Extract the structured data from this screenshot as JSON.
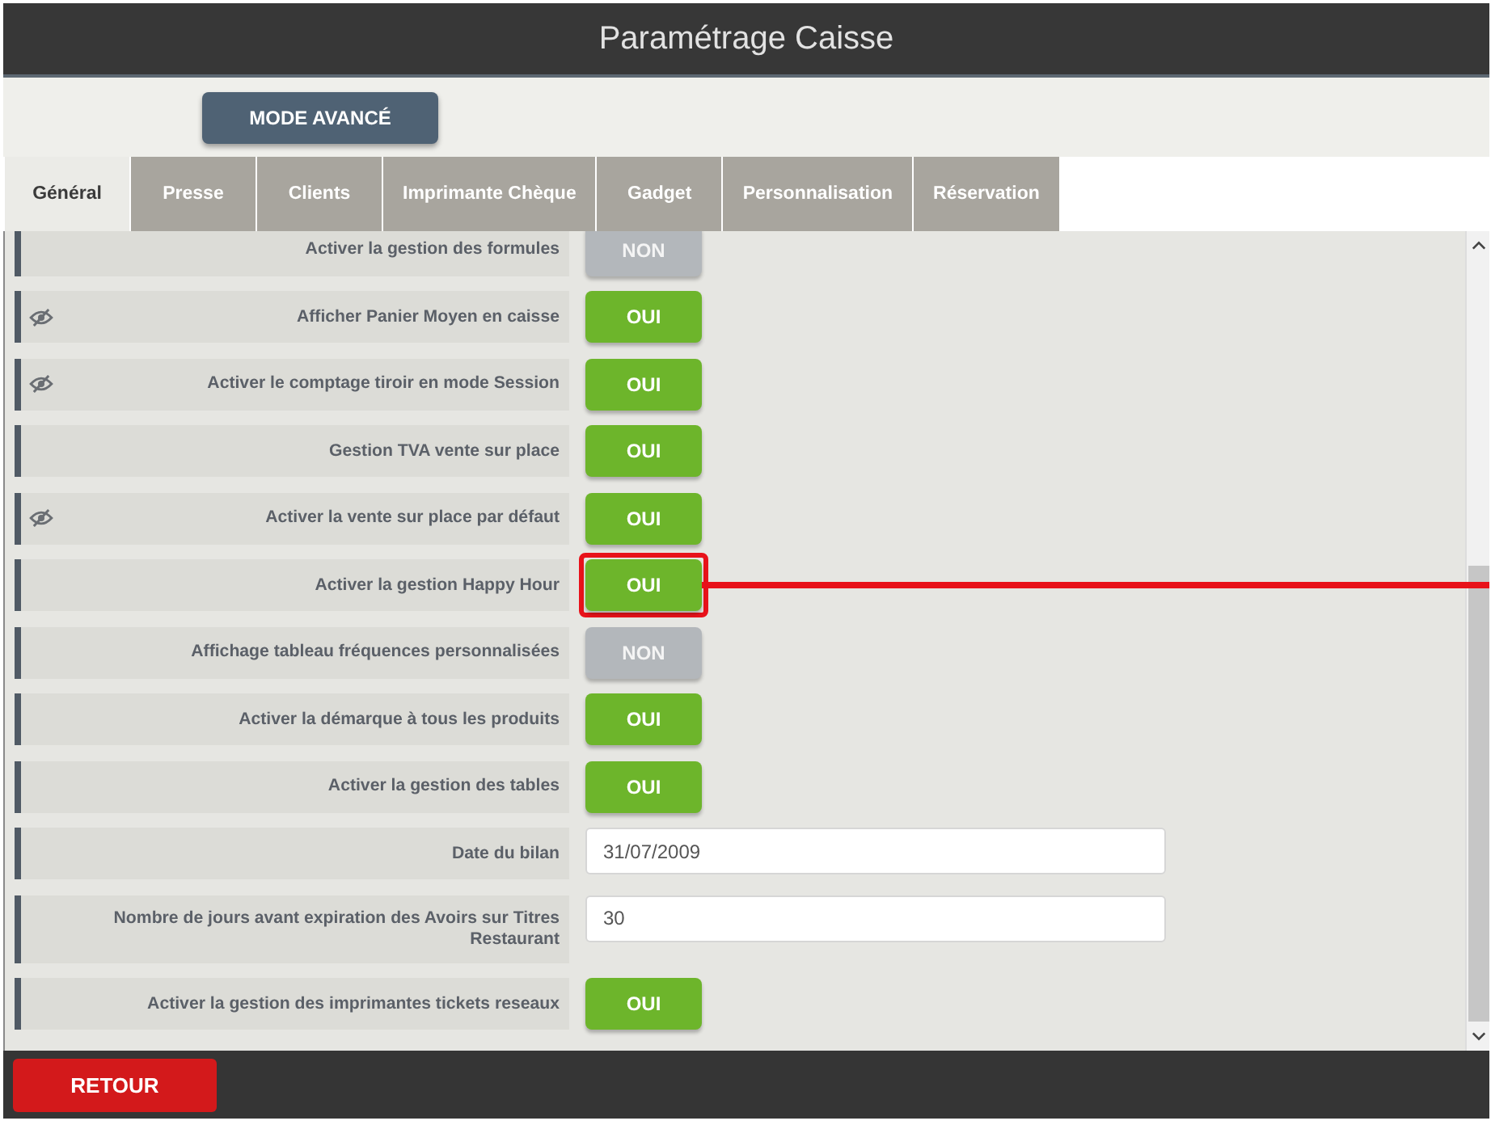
{
  "window": {
    "title": "Paramétrage Caisse"
  },
  "toolbar": {
    "mode_button": "MODE AVANCÉ"
  },
  "tabs": [
    {
      "label": "Général",
      "selected": true
    },
    {
      "label": "Presse",
      "selected": false
    },
    {
      "label": "Clients",
      "selected": false
    },
    {
      "label": "Imprimante Chèque",
      "selected": false
    },
    {
      "label": "Gadget",
      "selected": false
    },
    {
      "label": "Personnalisation",
      "selected": false
    },
    {
      "label": "Réservation",
      "selected": false
    }
  ],
  "settings": [
    {
      "kind": "toggle",
      "label": "Activer la gestion des formules",
      "value": "NON",
      "on": false,
      "eye_icon": false,
      "highlighted": false
    },
    {
      "kind": "toggle",
      "label": "Afficher Panier Moyen en caisse",
      "value": "OUI",
      "on": true,
      "eye_icon": true,
      "highlighted": false
    },
    {
      "kind": "toggle",
      "label": "Activer le comptage tiroir en mode Session",
      "value": "OUI",
      "on": true,
      "eye_icon": true,
      "highlighted": false
    },
    {
      "kind": "toggle",
      "label": "Gestion TVA vente sur place",
      "value": "OUI",
      "on": true,
      "eye_icon": false,
      "highlighted": false
    },
    {
      "kind": "toggle",
      "label": "Activer la vente sur place par défaut",
      "value": "OUI",
      "on": true,
      "eye_icon": true,
      "highlighted": false
    },
    {
      "kind": "toggle",
      "label": "Activer la gestion Happy Hour",
      "value": "OUI",
      "on": true,
      "eye_icon": false,
      "highlighted": true
    },
    {
      "kind": "toggle",
      "label": "Affichage tableau fréquences personnalisées",
      "value": "NON",
      "on": false,
      "eye_icon": false,
      "highlighted": false
    },
    {
      "kind": "toggle",
      "label": "Activer la démarque à tous les produits",
      "value": "OUI",
      "on": true,
      "eye_icon": false,
      "highlighted": false
    },
    {
      "kind": "toggle",
      "label": "Activer la gestion des tables",
      "value": "OUI",
      "on": true,
      "eye_icon": false,
      "highlighted": false
    },
    {
      "kind": "text",
      "label": "Date du bilan",
      "value": "31/07/2009",
      "eye_icon": false,
      "highlighted": false
    },
    {
      "kind": "text",
      "label": "Nombre de jours avant expiration des Avoirs sur Titres Restaurant",
      "value": "30",
      "eye_icon": false,
      "highlighted": false
    },
    {
      "kind": "toggle",
      "label": "Activer la gestion des imprimantes tickets reseaux",
      "value": "OUI",
      "on": true,
      "eye_icon": false,
      "highlighted": false
    }
  ],
  "footer": {
    "back_button": "RETOUR"
  }
}
